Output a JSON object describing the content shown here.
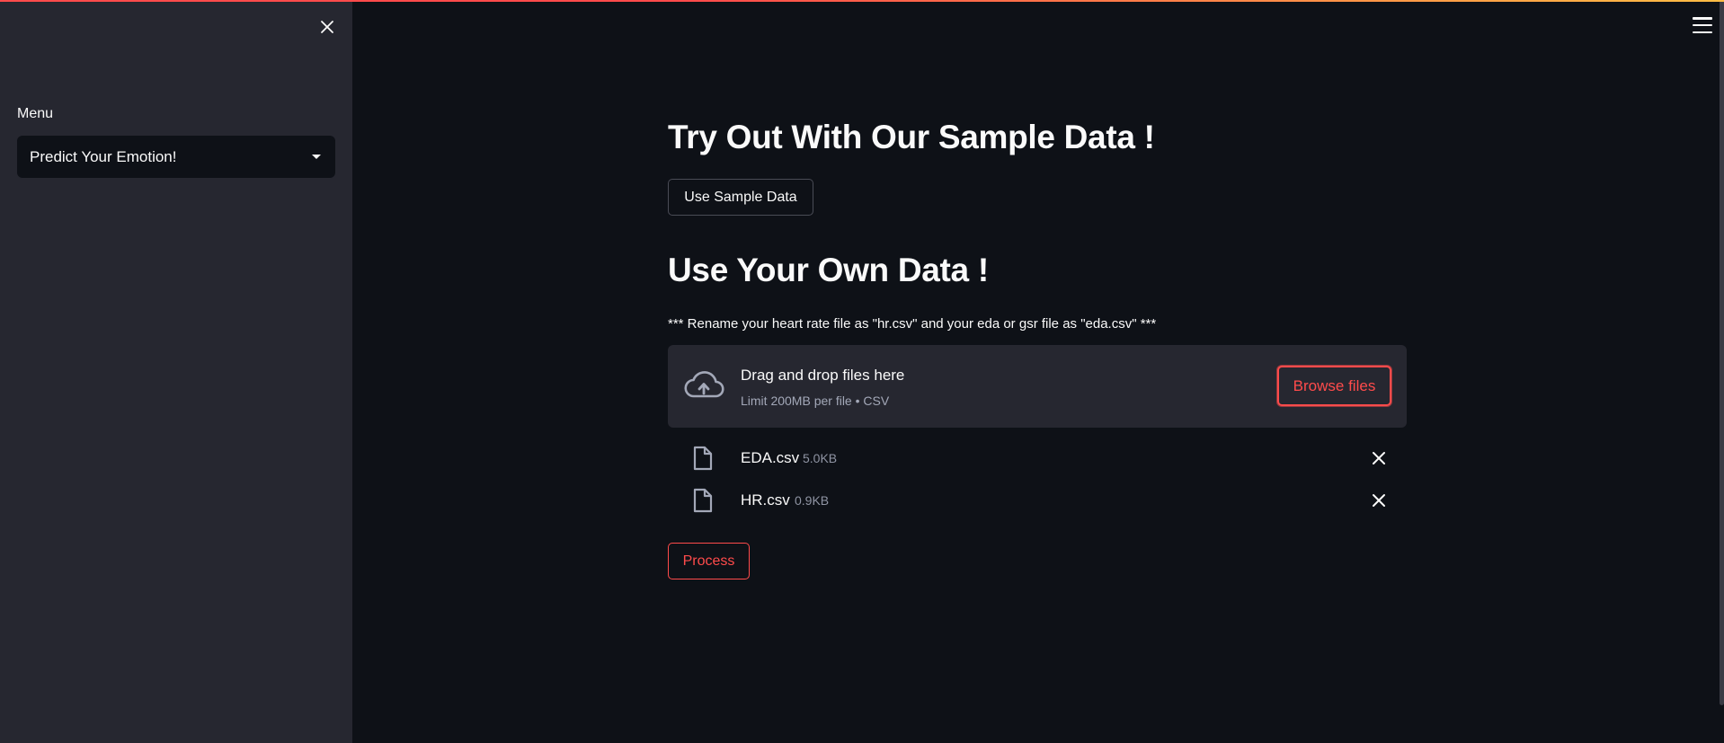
{
  "sidebar": {
    "close_icon": "close-icon",
    "menu_label": "Menu",
    "menu_selected": "Predict Your Emotion!"
  },
  "header": {
    "menu_icon": "hamburger-icon"
  },
  "main": {
    "sample_heading": "Try Out With Our Sample Data !",
    "sample_button": "Use Sample Data",
    "own_heading": "Use Your Own Data !",
    "rename_note": "*** Rename your heart rate file as \"hr.csv\" and your eda or gsr file as \"eda.csv\" ***",
    "uploader": {
      "title": "Drag and drop files here",
      "limit": "Limit 200MB per file • CSV",
      "browse_button": "Browse files",
      "icon": "cloud-upload-icon"
    },
    "files": [
      {
        "name": "EDA.csv",
        "size": "5.0KB"
      },
      {
        "name": "HR.csv",
        "size": "0.9KB"
      }
    ],
    "process_button": "Process"
  },
  "colors": {
    "background": "#0e1117",
    "sidebar": "#262730",
    "accent": "#ff4b4b",
    "text": "#fafafa",
    "muted": "#a3a8b8"
  }
}
